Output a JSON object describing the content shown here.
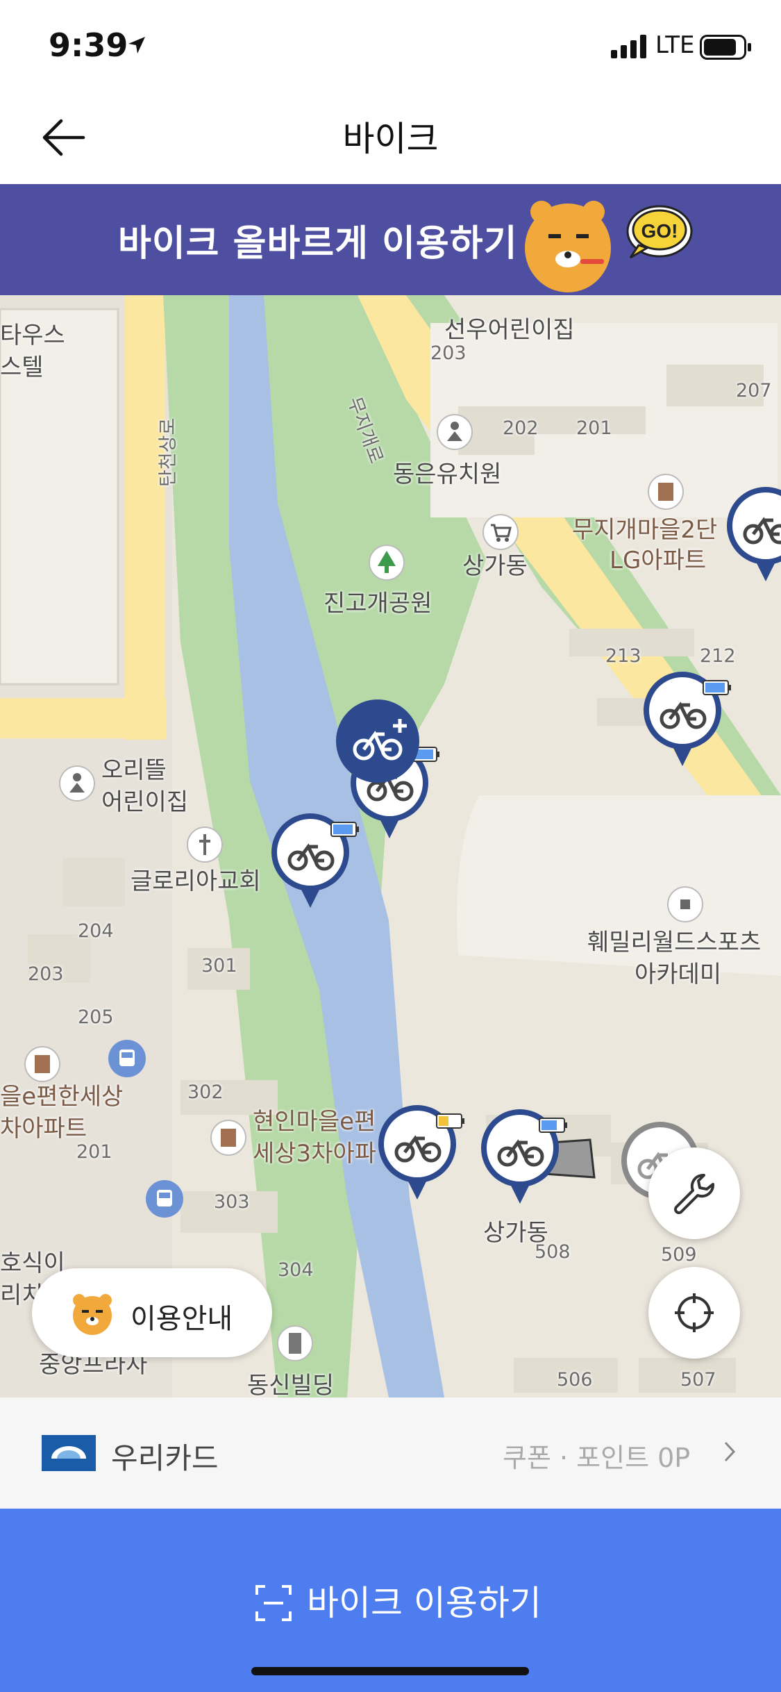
{
  "status_bar": {
    "time": "9:39",
    "network": "LTE"
  },
  "header": {
    "title": "바이크"
  },
  "banner": {
    "text": "바이크 올바르게 이용하기",
    "badge": "GO!"
  },
  "map": {
    "labels": [
      "타우스",
      "스텔",
      "선우어린이집",
      "무지개로",
      "동은유치원",
      "무지개마을2단",
      "LG아파트",
      "상가동",
      "진고개공원",
      "탄천상로",
      "오리뜰",
      "어린이집",
      "글로리아교회",
      "훼밀리월드스포츠",
      "아카데미",
      "을e편한세상",
      "차아파트",
      "현인마을e편",
      "세상3차아파",
      "상가동",
      "호식이",
      "리치",
      "중앙프라자",
      "동신빌딩"
    ],
    "building_numbers": [
      "203",
      "207",
      "202",
      "201",
      "213",
      "212",
      "204",
      "203",
      "205",
      "301",
      "302",
      "201",
      "303",
      "304",
      "508",
      "509",
      "506",
      "507"
    ]
  },
  "guide_button": {
    "label": "이용안내"
  },
  "payment": {
    "card": "우리카드",
    "coupon": "쿠폰 · 포인트 0P"
  },
  "cta": {
    "label": "바이크 이용하기"
  },
  "colors": {
    "accent": "#4e7df0",
    "banner": "#4e4fa0",
    "pin": "#2d4a8f"
  }
}
